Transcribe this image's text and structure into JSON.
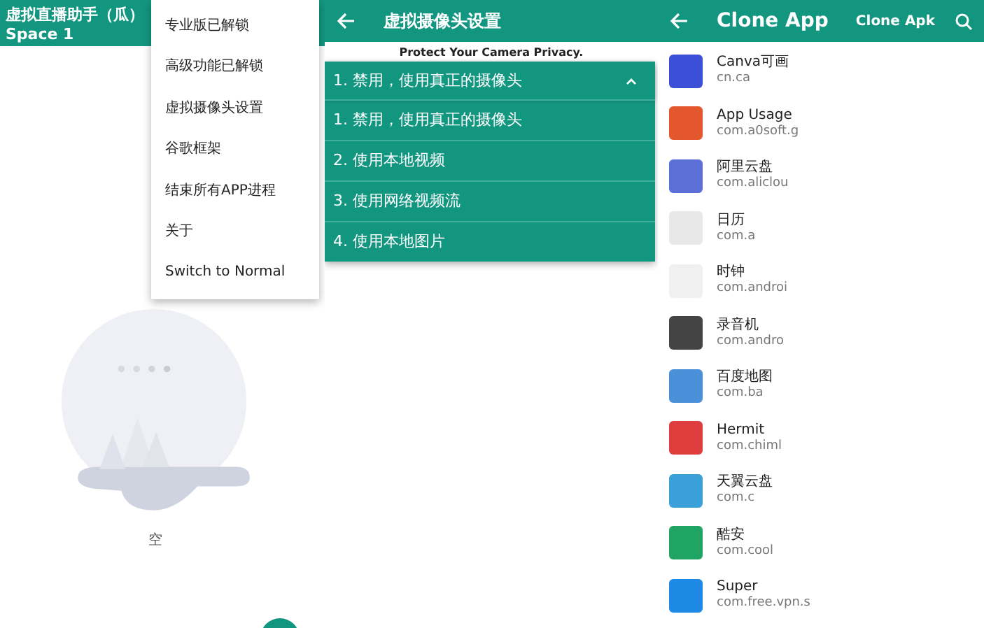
{
  "home": {
    "title": "虚拟直播助手（瓜）",
    "subtitle": "Space 1",
    "empty_text": "空",
    "menu": [
      {
        "label": "专业版已解锁"
      },
      {
        "label": "高级功能已解锁"
      },
      {
        "label": "虚拟摄像头设置"
      },
      {
        "label": "谷歌框架"
      },
      {
        "label": "结束所有APP进程"
      },
      {
        "label": "关于"
      },
      {
        "label": "Switch to Normal"
      }
    ]
  },
  "camera": {
    "title": "虚拟摄像头设置",
    "note": "Protect Your Camera Privacy.",
    "dropdown": {
      "value": "1. 禁用，使用真正的摄像头",
      "expanded": true,
      "options": [
        "1. 禁用，使用真正的摄像头",
        "2. 使用本地视频",
        "3. 使用网络视频流",
        "4. 使用本地图片"
      ]
    }
  },
  "clone": {
    "title": "Clone App",
    "action": "Clone Apk",
    "apps": [
      {
        "name": "Canva可画",
        "package": "cn.ca"
      },
      {
        "name": "App Usage",
        "package": "com.a0soft.g"
      },
      {
        "name": "阿里云盘",
        "package": "com.aliclou"
      },
      {
        "name": "日历",
        "package": "com.a"
      },
      {
        "name": "时钟",
        "package": "com.androi"
      },
      {
        "name": "录音机",
        "package": "com.andro"
      },
      {
        "name": "百度地图",
        "package": "com.ba"
      },
      {
        "name": "Hermit",
        "package": "com.chiml"
      },
      {
        "name": "天翼云盘",
        "package": "com.c"
      },
      {
        "name": "酷安",
        "package": "com.cool"
      },
      {
        "name": "Super",
        "package": "com.free.vpn.s"
      }
    ]
  }
}
